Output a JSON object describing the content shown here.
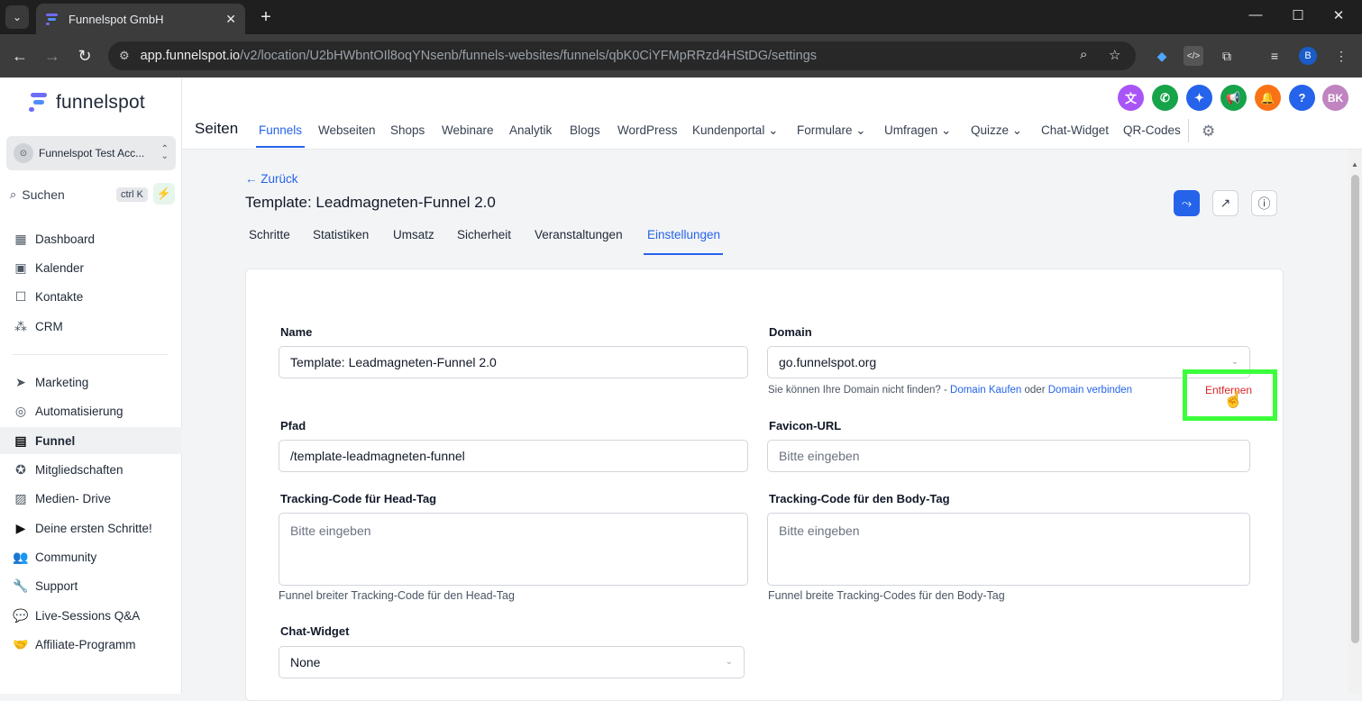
{
  "browser": {
    "tab_title": "Funnelspot GmbH",
    "url_host": "app.funnelspot.io",
    "url_path": "/v2/location/U2bHWbntOIl8oqYNsenb/funnels-websites/funnels/qbK0CiYFMpRRzd4HStDG/settings",
    "profile_initial": "B"
  },
  "sidebar": {
    "logo_text": "funnelspot",
    "account_name": "Funnelspot Test Acc...",
    "search_label": "Suchen",
    "search_shortcut": "ctrl K",
    "items": [
      {
        "label": "Dashboard",
        "icon": "dashboard-icon"
      },
      {
        "label": "Kalender",
        "icon": "calendar-icon"
      },
      {
        "label": "Kontakte",
        "icon": "contacts-icon"
      },
      {
        "label": "CRM",
        "icon": "crm-icon"
      },
      {
        "label": "Marketing",
        "icon": "send-icon"
      },
      {
        "label": "Automatisierung",
        "icon": "play-circle-icon"
      },
      {
        "label": "Funnel",
        "icon": "funnel-icon",
        "active": true
      },
      {
        "label": "Mitgliedschaften",
        "icon": "badge-icon"
      },
      {
        "label": "Medien- Drive",
        "icon": "image-icon"
      },
      {
        "label": "Deine ersten Schritte!",
        "icon": "play-icon"
      },
      {
        "label": "Community",
        "icon": "people-icon"
      },
      {
        "label": "Support",
        "icon": "wrench-icon"
      },
      {
        "label": "Live-Sessions Q&A",
        "icon": "chat-icon"
      },
      {
        "label": "Affiliate-Programm",
        "icon": "handshake-icon"
      }
    ]
  },
  "topbar": {
    "page_heading": "Seiten",
    "user_initials": "BK",
    "menu": [
      {
        "label": "Funnels",
        "active": true
      },
      {
        "label": "Webseiten"
      },
      {
        "label": "Shops"
      },
      {
        "label": "Webinare"
      },
      {
        "label": "Analytik"
      },
      {
        "label": "Blogs"
      },
      {
        "label": "WordPress"
      },
      {
        "label": "Kundenportal",
        "dropdown": true
      },
      {
        "label": "Formulare",
        "dropdown": true
      },
      {
        "label": "Umfragen",
        "dropdown": true
      },
      {
        "label": "Quizze",
        "dropdown": true
      },
      {
        "label": "Chat-Widget"
      },
      {
        "label": "QR-Codes"
      }
    ],
    "colors": {
      "translate": "#a855f7",
      "phone": "#16a34a",
      "ai": "#2563eb",
      "announce": "#16a34a",
      "notify": "#f97316",
      "help": "#2563eb",
      "avatar": "#c084c0"
    }
  },
  "content": {
    "back_label": "← Zurück",
    "funnel_title": "Template: Leadmagneten-Funnel 2.0",
    "subtabs": [
      "Schritte",
      "Statistiken",
      "Umsatz",
      "Sicherheit",
      "Veranstaltungen",
      "Einstellungen"
    ],
    "active_subtab": "Einstellungen",
    "form": {
      "name_label": "Name",
      "name_value": "Template: Leadmagneten-Funnel 2.0",
      "domain_label": "Domain",
      "domain_value": "go.funnelspot.org",
      "domain_help": "Sie können Ihre Domain nicht finden? -",
      "domain_buy": "Domain Kaufen",
      "domain_or": "oder",
      "domain_connect": "Domain verbinden",
      "domain_remove": "Entfernen",
      "path_label": "Pfad",
      "path_value": "/template-leadmagneten-funnel",
      "favicon_label": "Favicon-URL",
      "favicon_placeholder": "Bitte eingeben",
      "head_label": "Tracking-Code für Head-Tag",
      "head_placeholder": "Bitte eingeben",
      "head_help": "Funnel breiter Tracking-Code für den Head-Tag",
      "body_label": "Tracking-Code für den Body-Tag",
      "body_placeholder": "Bitte eingeben",
      "body_help": "Funnel breite Tracking-Codes für den Body-Tag",
      "chat_label": "Chat-Widget",
      "chat_value": "None"
    }
  }
}
